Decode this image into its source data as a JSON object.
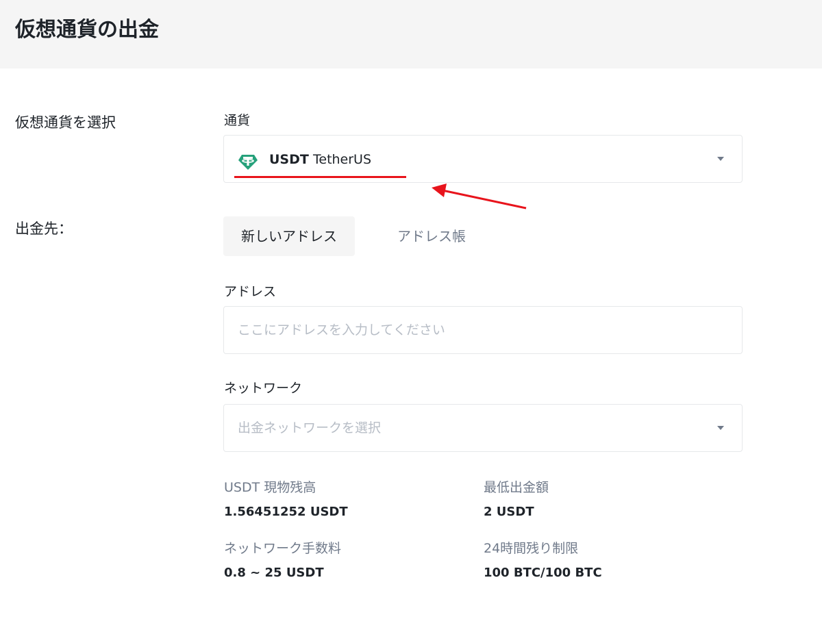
{
  "header": {
    "title": "仮想通貨の出金"
  },
  "select_crypto": {
    "section_label": "仮想通貨を選択",
    "field_label": "通貨",
    "selected_symbol": "USDT",
    "selected_name": "TetherUS",
    "coin_icon": "tether-icon",
    "coin_color": "#26a17b"
  },
  "destination": {
    "section_label": "出金先：",
    "tabs": [
      {
        "label": "新しいアドレス",
        "active": true
      },
      {
        "label": "アドレス帳",
        "active": false
      }
    ],
    "address_label": "アドレス",
    "address_placeholder": "ここにアドレスを入力してください",
    "network_label": "ネットワーク",
    "network_placeholder": "出金ネットワークを選択"
  },
  "info": {
    "balance_label": "USDT 現物残高",
    "balance_value": "1.56451252 USDT",
    "min_label": "最低出金額",
    "min_value": "2 USDT",
    "fee_label": "ネットワーク手数料",
    "fee_value": "0.8 ~ 25 USDT",
    "limit_label": "24時間残り制限",
    "limit_value": "100 BTC/100 BTC"
  },
  "annotation": {
    "highlight_color": "#e8141c"
  }
}
